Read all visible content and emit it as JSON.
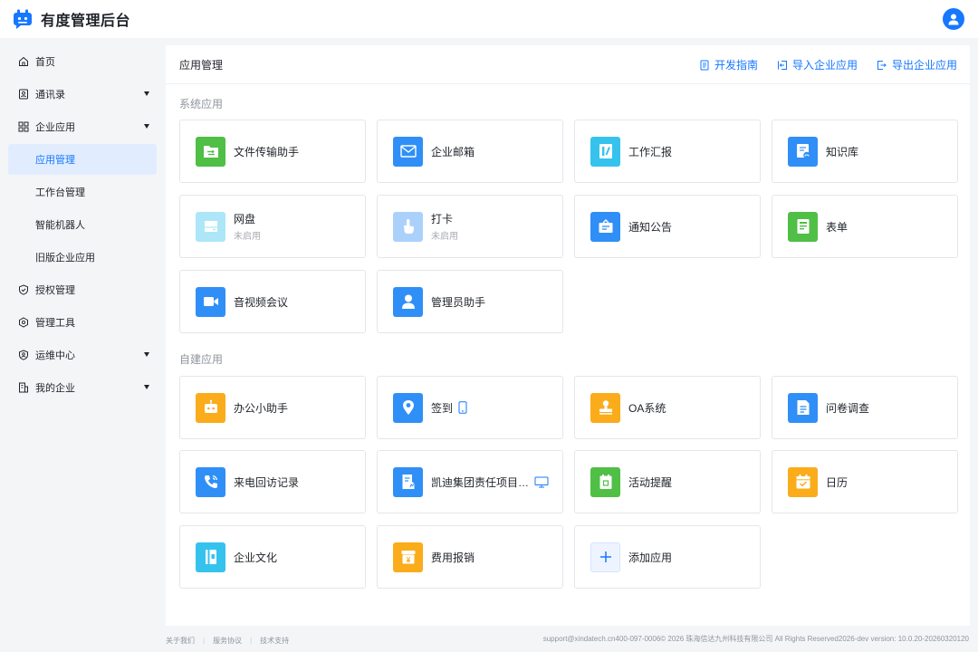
{
  "app": {
    "title": "有度管理后台"
  },
  "sidebar": {
    "items": [
      {
        "label": "首页",
        "icon": "home-icon"
      },
      {
        "label": "通讯录",
        "icon": "contacts-icon",
        "expandable": true
      },
      {
        "label": "企业应用",
        "icon": "apps-grid-icon",
        "expandable": true
      },
      {
        "label": "应用管理",
        "active": true
      },
      {
        "label": "工作台管理"
      },
      {
        "label": "智能机器人"
      },
      {
        "label": "旧版企业应用"
      },
      {
        "label": "授权管理",
        "icon": "shield-check-icon"
      },
      {
        "label": "管理工具",
        "icon": "tools-cube-icon"
      },
      {
        "label": "运维中心",
        "icon": "user-shield-icon",
        "expandable": true
      },
      {
        "label": "我的企业",
        "icon": "building-icon",
        "expandable": true
      }
    ]
  },
  "main": {
    "title": "应用管理",
    "actions": {
      "dev_guide": "开发指南",
      "import_app": "导入企业应用",
      "export_app": "导出企业应用"
    },
    "system_section": "系统应用",
    "custom_section": "自建应用",
    "system_apps": [
      {
        "name": "文件传输助手",
        "icon": "file-transfer-icon",
        "color": "#4fbf45"
      },
      {
        "name": "企业邮箱",
        "icon": "mail-icon",
        "color": "#2f8ff7"
      },
      {
        "name": "工作汇报",
        "icon": "report-icon",
        "color": "#35c3ee"
      },
      {
        "name": "知识库",
        "icon": "knowledge-base-icon",
        "color": "#2f8ff7"
      },
      {
        "name": "网盘",
        "sub": "未启用",
        "icon": "cloud-disk-icon",
        "color": "#35c3ee"
      },
      {
        "name": "打卡",
        "sub": "未启用",
        "icon": "punch-in-icon",
        "color": "#2f8ff7"
      },
      {
        "name": "通知公告",
        "icon": "announcement-icon",
        "color": "#2f8ff7"
      },
      {
        "name": "表单",
        "icon": "form-icon",
        "color": "#4fbf45"
      },
      {
        "name": "音视频会议",
        "icon": "video-meeting-icon",
        "color": "#2f8ff7"
      },
      {
        "name": "管理员助手",
        "icon": "admin-assistant-icon",
        "color": "#2f8ff7"
      }
    ],
    "custom_apps": [
      {
        "name": "办公小助手",
        "icon": "robot-icon",
        "color": "#fbac1b"
      },
      {
        "name": "签到",
        "icon": "check-in-icon",
        "color": "#2f8ff7",
        "trail": "mobile-icon"
      },
      {
        "name": "OA系统",
        "icon": "stamp-icon",
        "color": "#fbac1b"
      },
      {
        "name": "问卷调查",
        "icon": "survey-icon",
        "color": "#2f8ff7"
      },
      {
        "name": "来电回访记录",
        "icon": "phone-call-icon",
        "color": "#2f8ff7"
      },
      {
        "name": "凯迪集团责任项目…",
        "icon": "project-doc-icon",
        "color": "#2f8ff7",
        "trail": "desktop-icon"
      },
      {
        "name": "活动提醒",
        "icon": "activity-reminder-icon",
        "color": "#4fbf45"
      },
      {
        "name": "日历",
        "icon": "calendar-icon",
        "color": "#fbac1b"
      },
      {
        "name": "企业文化",
        "icon": "culture-book-icon",
        "color": "#35c3ee"
      },
      {
        "name": "费用报销",
        "icon": "expense-icon",
        "color": "#fbac1b"
      },
      {
        "name": "添加应用",
        "icon": "plus-icon",
        "color": "#eef4ff"
      }
    ]
  },
  "footer": {
    "about": "关于我们",
    "terms": "服务协议",
    "support": "技术支持",
    "copyright": "support@xindatech.cn400-097-0006© 2026 珠海信达九州科技有限公司 All Rights Reserved2026-dev version: 10.0.20-20260320120"
  }
}
